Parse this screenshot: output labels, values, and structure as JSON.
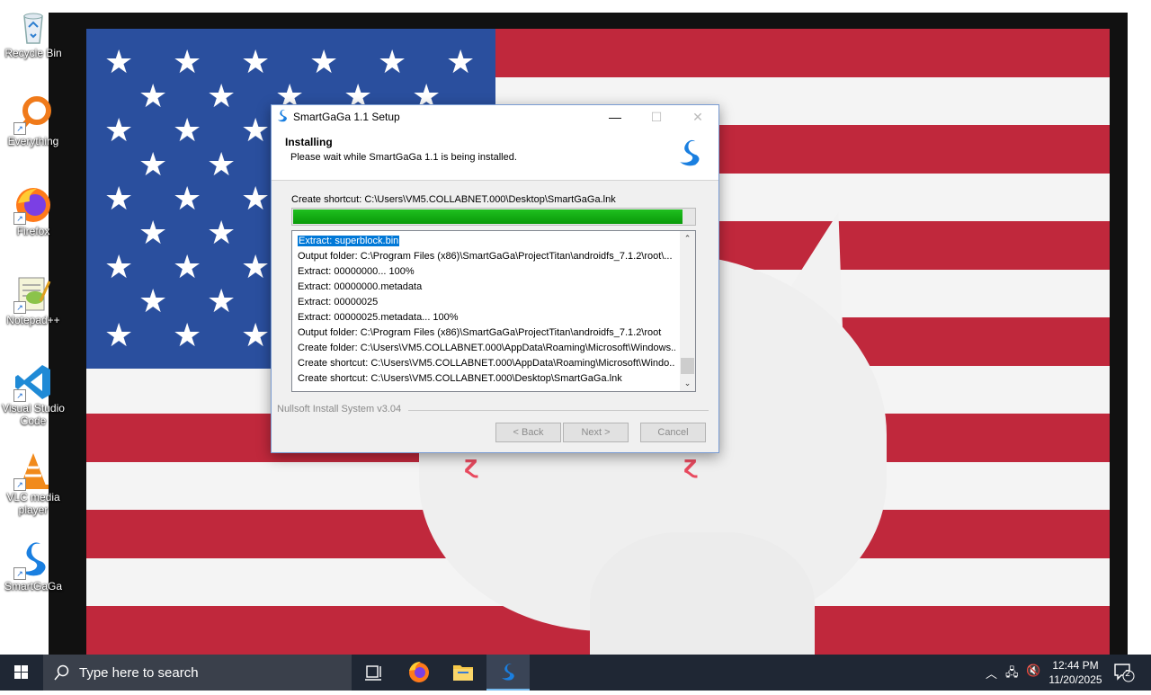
{
  "desktop": {
    "icons": [
      {
        "label": "Recycle Bin",
        "icon": "recycle-bin-icon"
      },
      {
        "label": "Everything",
        "icon": "everything-search-icon"
      },
      {
        "label": "Firefox",
        "icon": "firefox-icon"
      },
      {
        "label": "Notepad++",
        "icon": "notepad-plus-plus-icon"
      },
      {
        "label": "Visual Studio Code",
        "icon": "vscode-icon"
      },
      {
        "label": "VLC media player",
        "icon": "vlc-icon"
      },
      {
        "label": "SmartGaGa",
        "icon": "smartgaga-swan-icon"
      }
    ]
  },
  "dialog": {
    "title": "SmartGaGa 1.1 Setup",
    "header_title": "Installing",
    "header_subtitle": "Please wait while SmartGaGa 1.1 is being installed.",
    "status": "Create shortcut: C:\\Users\\VM5.COLLABNET.000\\Desktop\\SmartGaGa.lnk",
    "progress": 0.97,
    "log": [
      "Extract: superblock.bin",
      "Output folder: C:\\Program Files (x86)\\SmartGaGa\\ProjectTitan\\androidfs_7.1.2\\root\\...",
      "Extract: 00000000... 100%",
      "Extract: 00000000.metadata",
      "Extract: 00000025",
      "Extract: 00000025.metadata... 100%",
      "Output folder: C:\\Program Files (x86)\\SmartGaGa\\ProjectTitan\\androidfs_7.1.2\\root",
      "Create folder: C:\\Users\\VM5.COLLABNET.000\\AppData\\Roaming\\Microsoft\\Windows...",
      "Create shortcut: C:\\Users\\VM5.COLLABNET.000\\AppData\\Roaming\\Microsoft\\Windo...",
      "Create shortcut: C:\\Users\\VM5.COLLABNET.000\\Desktop\\SmartGaGa.lnk"
    ],
    "branding": "Nullsoft Install System v3.04",
    "buttons": {
      "back": "< Back",
      "next": "Next >",
      "cancel": "Cancel"
    },
    "accent_color": "#0078d7",
    "progress_color": "#16b016"
  },
  "taskbar": {
    "search_placeholder": "Type here to search",
    "apps": [
      "task-view-icon",
      "firefox-icon",
      "file-explorer-icon",
      "smartgaga-swan-icon"
    ],
    "time": "12:44 PM",
    "date": "11/20/2025",
    "notification_count": "2"
  }
}
